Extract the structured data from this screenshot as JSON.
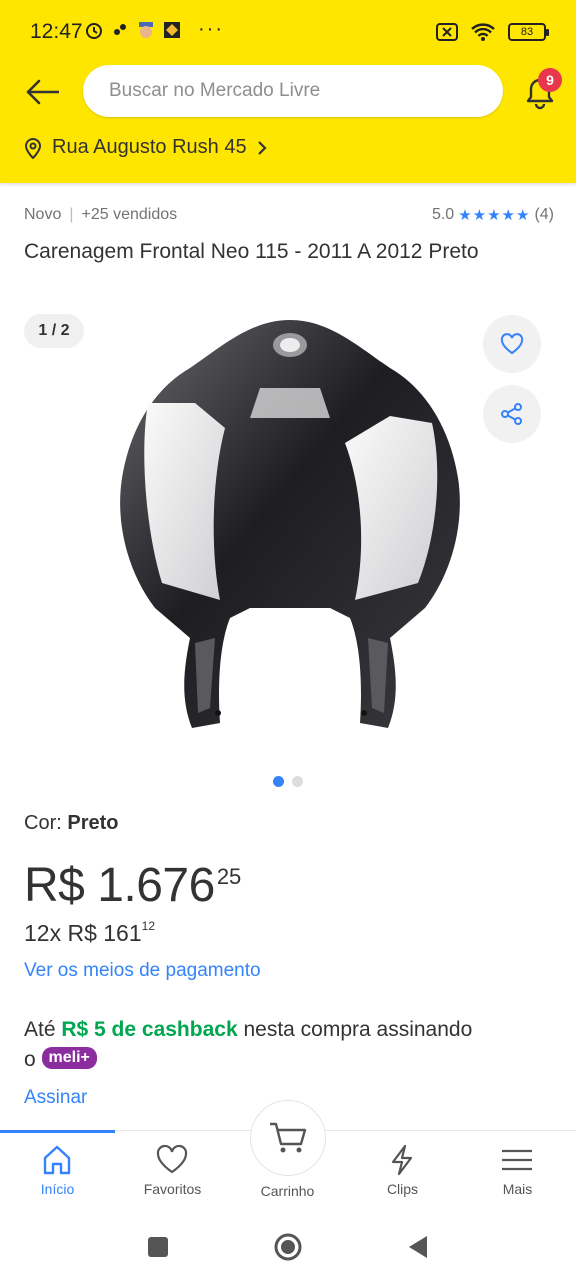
{
  "status_bar": {
    "time": "12:47",
    "dots": "···",
    "battery": "83"
  },
  "header": {
    "search_placeholder": "Buscar no Mercado Livre",
    "notification_count": "9",
    "address": "Rua Augusto Rush 45"
  },
  "product": {
    "condition": "Novo",
    "sold": "+25 vendidos",
    "rating": "5.0",
    "stars": "★★★★★",
    "review_count": "(4)",
    "title": "Carenagem Frontal Neo 115 - 2011 A 2012 Preto",
    "image_counter": "1 / 2",
    "color_label": "Cor:",
    "color_value": "Preto",
    "price_main": "R$ 1.676",
    "price_cents": "25",
    "installments_prefix": "12x R$ 161",
    "installments_cents": "12",
    "payment_link": "Ver os meios de pagamento"
  },
  "cashback": {
    "prefix": "Até ",
    "highlight": "R$ 5 de cashback",
    "suffix": " nesta compra assinando",
    "line2_prefix": "o ",
    "badge": "meli+",
    "link": "Assinar"
  },
  "bottom_nav": {
    "items": [
      {
        "label": "Início",
        "icon": "home-icon",
        "active": true
      },
      {
        "label": "Favoritos",
        "icon": "heart-icon",
        "active": false
      },
      {
        "label": "Carrinho",
        "icon": "cart-icon",
        "active": false
      },
      {
        "label": "Clips",
        "icon": "lightning-icon",
        "active": false
      },
      {
        "label": "Mais",
        "icon": "menu-icon",
        "active": false
      }
    ]
  },
  "colors": {
    "brand_yellow": "#ffe600",
    "link_blue": "#3483fa",
    "cashback_green": "#00a650",
    "meli_purple": "#8b2d9e",
    "badge_red": "#e8364c"
  }
}
